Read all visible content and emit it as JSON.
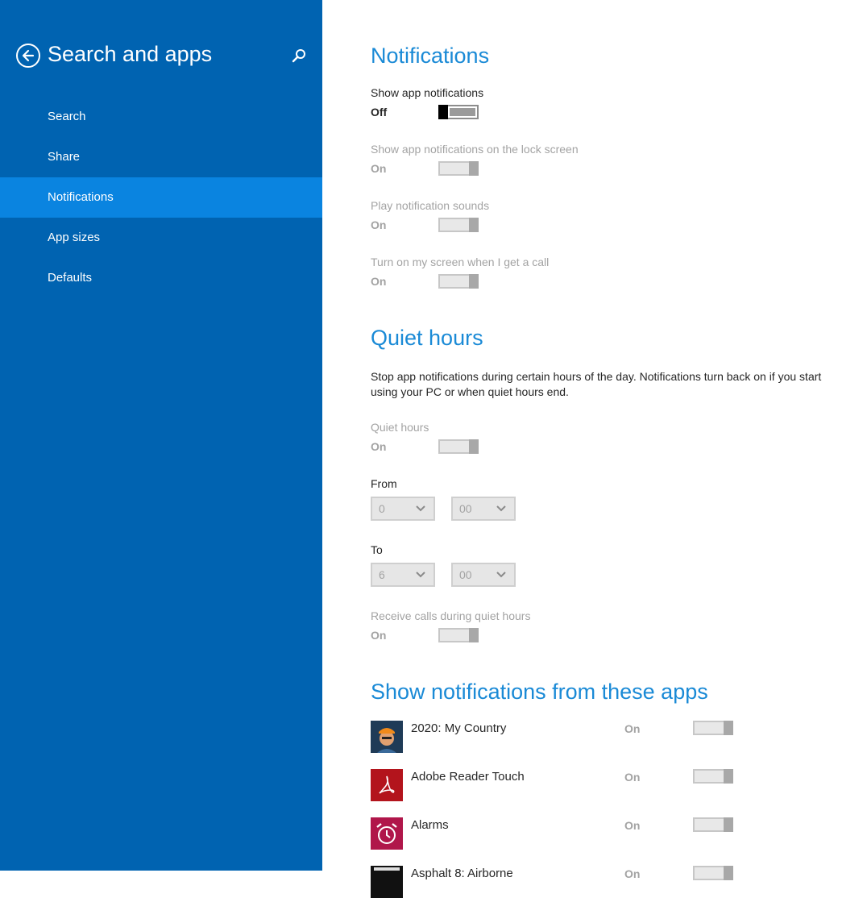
{
  "sidebar": {
    "title": "Search and apps",
    "items": [
      {
        "label": "Search"
      },
      {
        "label": "Share"
      },
      {
        "label": "Notifications"
      },
      {
        "label": "App sizes"
      },
      {
        "label": "Defaults"
      }
    ],
    "active_item": "Notifications",
    "accent_color": "#0063b1",
    "active_color": "#0a84e0"
  },
  "notifications": {
    "heading": "Notifications",
    "settings": [
      {
        "label": "Show app notifications",
        "state": "Off"
      },
      {
        "label": "Show app notifications on the lock screen",
        "state": "On"
      },
      {
        "label": "Play notification sounds",
        "state": "On"
      },
      {
        "label": "Turn on my screen when I get a call",
        "state": "On"
      }
    ]
  },
  "quiet_hours": {
    "heading": "Quiet hours",
    "description": "Stop app notifications during certain hours of the day. Notifications turn back on if you start using your PC or when quiet hours end.",
    "toggle_label": "Quiet hours",
    "toggle_state": "On",
    "from_label": "From",
    "from_hour": "0",
    "from_minute": "00",
    "to_label": "To",
    "to_hour": "6",
    "to_minute": "00",
    "calls_label": "Receive calls during quiet hours",
    "calls_state": "On"
  },
  "apps": {
    "heading": "Show notifications from these apps",
    "list": [
      {
        "name": "2020: My Country",
        "state": "On",
        "icon": "game-character-icon"
      },
      {
        "name": "Adobe Reader Touch",
        "state": "On",
        "icon": "adobe-reader-icon"
      },
      {
        "name": "Alarms",
        "state": "On",
        "icon": "alarm-clock-icon"
      },
      {
        "name": "Asphalt 8: Airborne",
        "state": "On",
        "icon": "asphalt-game-icon"
      }
    ]
  },
  "colors": {
    "heading_blue": "#1a8ad6",
    "disabled_text": "#a3a3a3"
  }
}
